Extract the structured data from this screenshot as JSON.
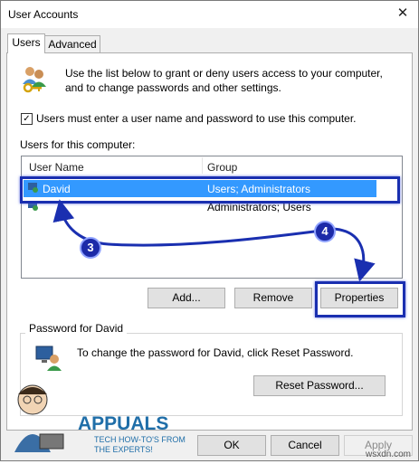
{
  "window": {
    "title": "User Accounts"
  },
  "tabs": [
    {
      "label": "Users",
      "active": true
    },
    {
      "label": "Advanced",
      "active": false
    }
  ],
  "intro": {
    "line1": "Use the list below to grant or deny users access to your computer,",
    "line2": "and to change passwords and other settings."
  },
  "checkbox": {
    "checked": true,
    "label": "Users must enter a user name and password to use this computer."
  },
  "users_section": {
    "label": "Users for this computer:",
    "columns": [
      "User Name",
      "Group"
    ],
    "rows": [
      {
        "name": "David",
        "group": "Users; Administrators",
        "selected": true
      },
      {
        "name": "",
        "group": "Administrators; Users",
        "selected": false
      }
    ]
  },
  "buttons": {
    "add": "Add...",
    "remove": "Remove",
    "properties": "Properties"
  },
  "password_section": {
    "title": "Password for David",
    "text": "To change the password for David, click Reset Password.",
    "reset_button": "Reset Password..."
  },
  "footer": {
    "ok": "OK",
    "cancel": "Cancel",
    "apply": "Apply"
  },
  "annotations": {
    "step3": "3",
    "step4": "4"
  },
  "watermark": {
    "brand": "APPUALS",
    "tagline1": "TECH HOW-TO'S FROM",
    "tagline2": "THE EXPERTS!",
    "site": "wsxdn.com"
  },
  "colors": {
    "highlight_box": "#1a2fb0",
    "selection": "#3399ff",
    "badge": "#1c2aa8"
  }
}
